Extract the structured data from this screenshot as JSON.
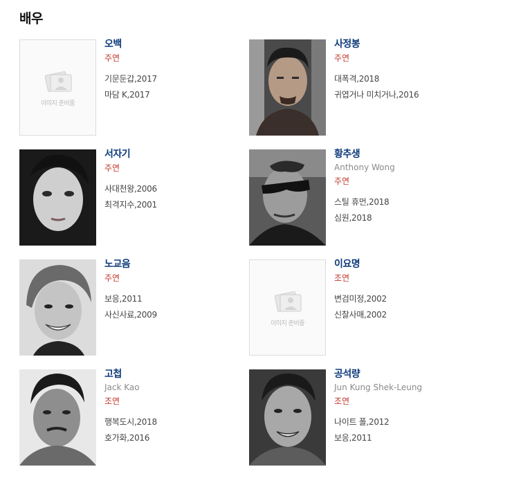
{
  "section_title": "배우",
  "placeholder_text": "이미지 준비중",
  "actors": [
    {
      "name": "오백",
      "english": "",
      "role": "주연",
      "photo": "placeholder",
      "works": [
        "기문둔갑,2017",
        "마담 K,2017"
      ]
    },
    {
      "name": "사정봉",
      "english": "",
      "role": "주연",
      "photo": "photo",
      "works": [
        "대폭격,2018",
        "귀엽거나 미치거나,2016"
      ]
    },
    {
      "name": "서자기",
      "english": "",
      "role": "주연",
      "photo": "photo",
      "works": [
        "사대천왕,2006",
        "최격지수,2001"
      ]
    },
    {
      "name": "황추생",
      "english": "Anthony Wong",
      "role": "주연",
      "photo": "photo",
      "works": [
        "스틸 휴먼,2018",
        "심원,2018"
      ]
    },
    {
      "name": "노교음",
      "english": "",
      "role": "주연",
      "photo": "photo",
      "works": [
        "보응,2011",
        "사신사료,2009"
      ]
    },
    {
      "name": "이요명",
      "english": "",
      "role": "조연",
      "photo": "placeholder",
      "works": [
        "변검미정,2002",
        "신찰사매,2002"
      ]
    },
    {
      "name": "고첩",
      "english": "Jack Kao",
      "role": "조연",
      "photo": "photo",
      "works": [
        "행복도시,2018",
        "호가화,2016"
      ]
    },
    {
      "name": "공석량",
      "english": "Jun Kung Shek-Leung",
      "role": "조연",
      "photo": "photo",
      "works": [
        "나이트 폴,2012",
        "보응,2011"
      ]
    }
  ]
}
